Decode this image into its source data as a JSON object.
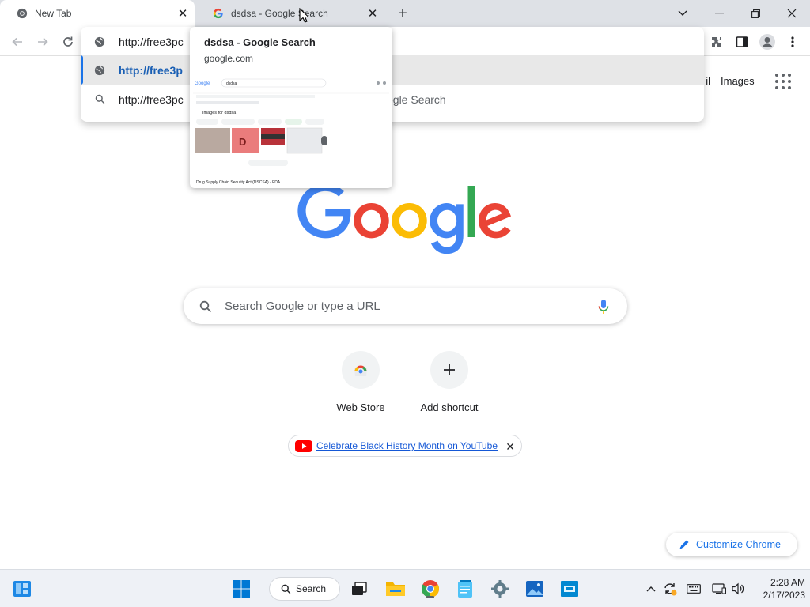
{
  "tabs": [
    {
      "title": "New Tab",
      "active": true,
      "icon": "chrome-icon"
    },
    {
      "title": "dsdsa - Google Search",
      "active": false,
      "icon": "google-g-icon"
    }
  ],
  "omnibox": {
    "rows": [
      {
        "icon": "globe-icon",
        "text": "http://free3pc"
      },
      {
        "icon": "globe-icon",
        "text": "http://free3p",
        "selected": true
      },
      {
        "icon": "search-icon",
        "text": "http://free3pc",
        "suffix": "ogle Search"
      }
    ]
  },
  "hovercard": {
    "title": "dsdsa - Google Search",
    "domain": "google.com",
    "thumb": {
      "search_term": "dsdsa",
      "images_heading": "Images for dsdsa",
      "result_title": "Drug Supply Chain Security Act (DSCSA) - FDA",
      "tile_letter": "D"
    }
  },
  "ntp": {
    "top_links": {
      "gmail_fragment": "il",
      "images": "Images"
    },
    "search_placeholder": "Search Google or type a URL",
    "shortcuts": [
      {
        "label": "Web Store",
        "icon": "web-store-icon"
      },
      {
        "label": "Add shortcut",
        "icon": "plus-icon"
      }
    ],
    "promo_text": "Celebrate Black History Month on YouTube",
    "customize_label": "Customize Chrome"
  },
  "taskbar": {
    "search_label": "Search",
    "time": "2:28 AM",
    "date": "2/17/2023"
  },
  "colors": {
    "google_blue": "#4285F4",
    "google_red": "#EA4335",
    "google_yellow": "#FBBC05",
    "google_green": "#34A853",
    "accent": "#1a73e8"
  }
}
